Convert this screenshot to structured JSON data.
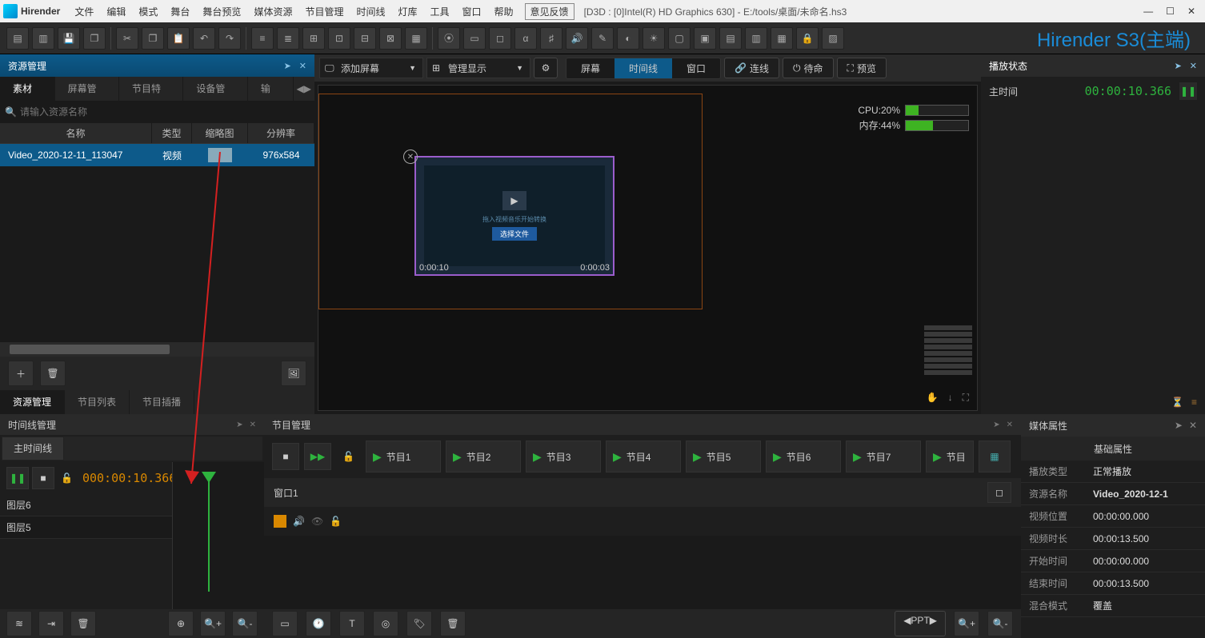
{
  "titlebar": {
    "app_name": "Hirender",
    "menu": [
      "文件",
      "编辑",
      "模式",
      "舞台",
      "舞台预览",
      "媒体资源",
      "节目管理",
      "时间线",
      "灯库",
      "工具",
      "窗口",
      "帮助"
    ],
    "feedback": "意见反馈",
    "path": "[D3D : [0]Intel(R) HD Graphics 630] - E:/tools/桌面/未命名.hs3"
  },
  "brand": "Hirender S3(主端)",
  "resource_panel": {
    "title": "资源管理",
    "tabs": [
      "素材库",
      "屏幕管理",
      "节目特效",
      "设备管理",
      "输入"
    ],
    "search_placeholder": "请输入资源名称",
    "columns": [
      "名称",
      "类型",
      "缩略图",
      "分辨率"
    ],
    "row": {
      "name": "Video_2020-12-11_113047",
      "type": "视频",
      "res": "976x584"
    },
    "bottom_tabs": [
      "资源管理",
      "节目列表",
      "节目插播"
    ]
  },
  "center": {
    "add_screen": "添加屏幕",
    "manage_display": "管理显示",
    "view_opts": [
      "屏幕",
      "时间线",
      "窗口"
    ],
    "connect": "连线",
    "standby": "待命",
    "preview": "预览",
    "clip": {
      "tc_left": "0:00:10",
      "tc_right": "0:00:03",
      "txt": "拖入视频音乐开始转换",
      "btn": "选择文件"
    },
    "stats": {
      "cpu_label": "CPU:20%",
      "cpu_pct": 20,
      "mem_label": "内存:44%",
      "mem_pct": 44
    }
  },
  "playback": {
    "title": "播放状态",
    "main_time_label": "主时间",
    "main_time": "00:00:10.366"
  },
  "timeline": {
    "title": "时间线管理",
    "tab": "主时间线",
    "timecode": "000:00:10.366",
    "layers": [
      "图层6",
      "图层5"
    ]
  },
  "program": {
    "title": "节目管理",
    "items": [
      "节目1",
      "节目2",
      "节目3",
      "节目4",
      "节目5",
      "节目6",
      "节目7",
      "节目"
    ],
    "window": "窗口1",
    "ppt": "◀PPT▶"
  },
  "props": {
    "title": "媒体属性",
    "subtitle": "基础属性",
    "rows": [
      {
        "label": "播放类型",
        "value": "正常播放"
      },
      {
        "label": "资源名称",
        "value": "Video_2020-12-1"
      },
      {
        "label": "视频位置",
        "value": "00:00:00.000"
      },
      {
        "label": "视频时长",
        "value": "00:00:13.500"
      },
      {
        "label": "开始时间",
        "value": "00:00:00.000"
      },
      {
        "label": "结束时间",
        "value": "00:00:13.500"
      },
      {
        "label": "混合模式",
        "value": "覆盖"
      }
    ]
  }
}
